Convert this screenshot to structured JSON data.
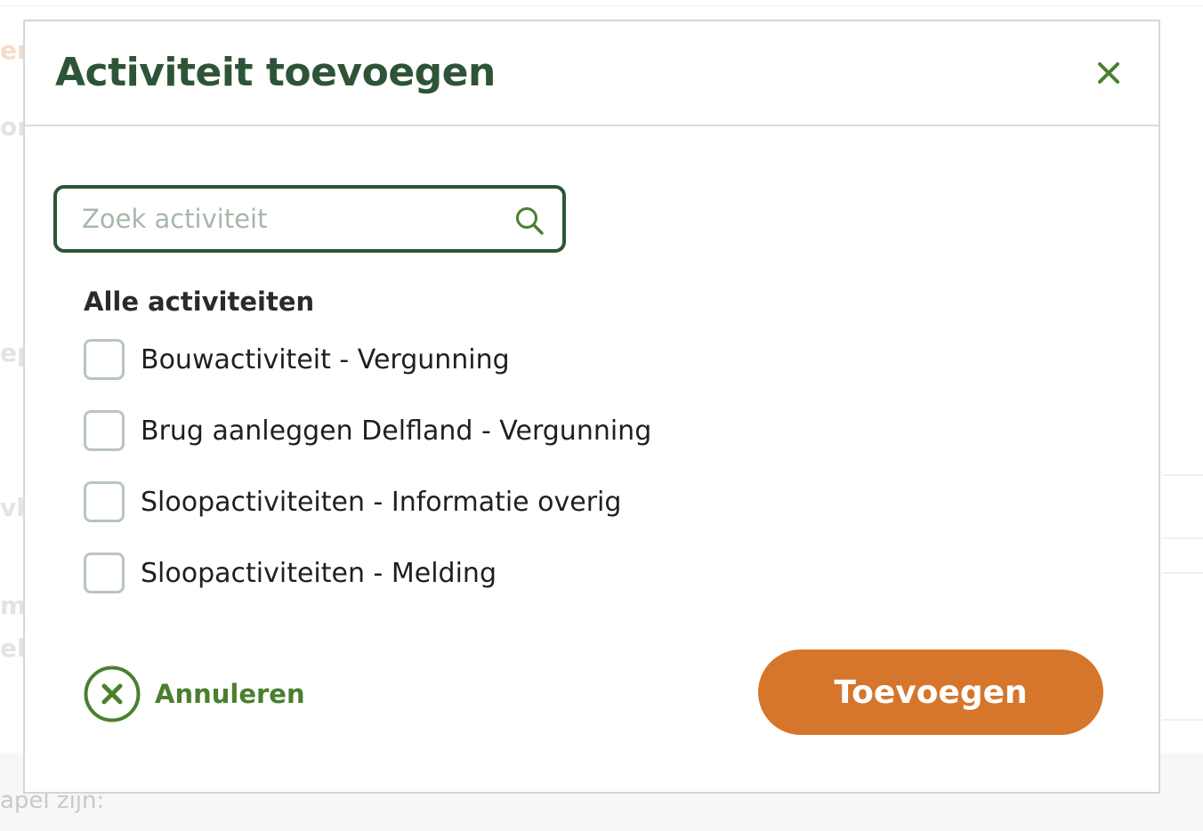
{
  "modal": {
    "title": "Activiteit toevoegen",
    "search": {
      "placeholder": "Zoek activiteit",
      "value": ""
    },
    "list": {
      "heading": "Alle activiteiten",
      "options": [
        {
          "label": "Bouwactiviteit - Vergunning",
          "checked": false
        },
        {
          "label": "Brug aanleggen Delfland - Vergunning",
          "checked": false
        },
        {
          "label": "Sloopactiviteiten - Informatie overig",
          "checked": false
        },
        {
          "label": "Sloopactiviteiten - Melding",
          "checked": false
        }
      ]
    },
    "cancel_label": "Annuleren",
    "submit_label": "Toevoegen"
  },
  "background": {
    "fragments": [
      "en",
      "or",
      "ep",
      "vk",
      "ma",
      "el"
    ],
    "footer_text": "apel zijn:"
  },
  "colors": {
    "title": "#2e5437",
    "accent_green": "#4a7f2e",
    "button_orange": "#d5762c",
    "checkbox_border": "#b8c6bb"
  },
  "icons": {
    "close": "close-icon",
    "search": "search-icon",
    "cancel": "cancel-circle-icon"
  }
}
